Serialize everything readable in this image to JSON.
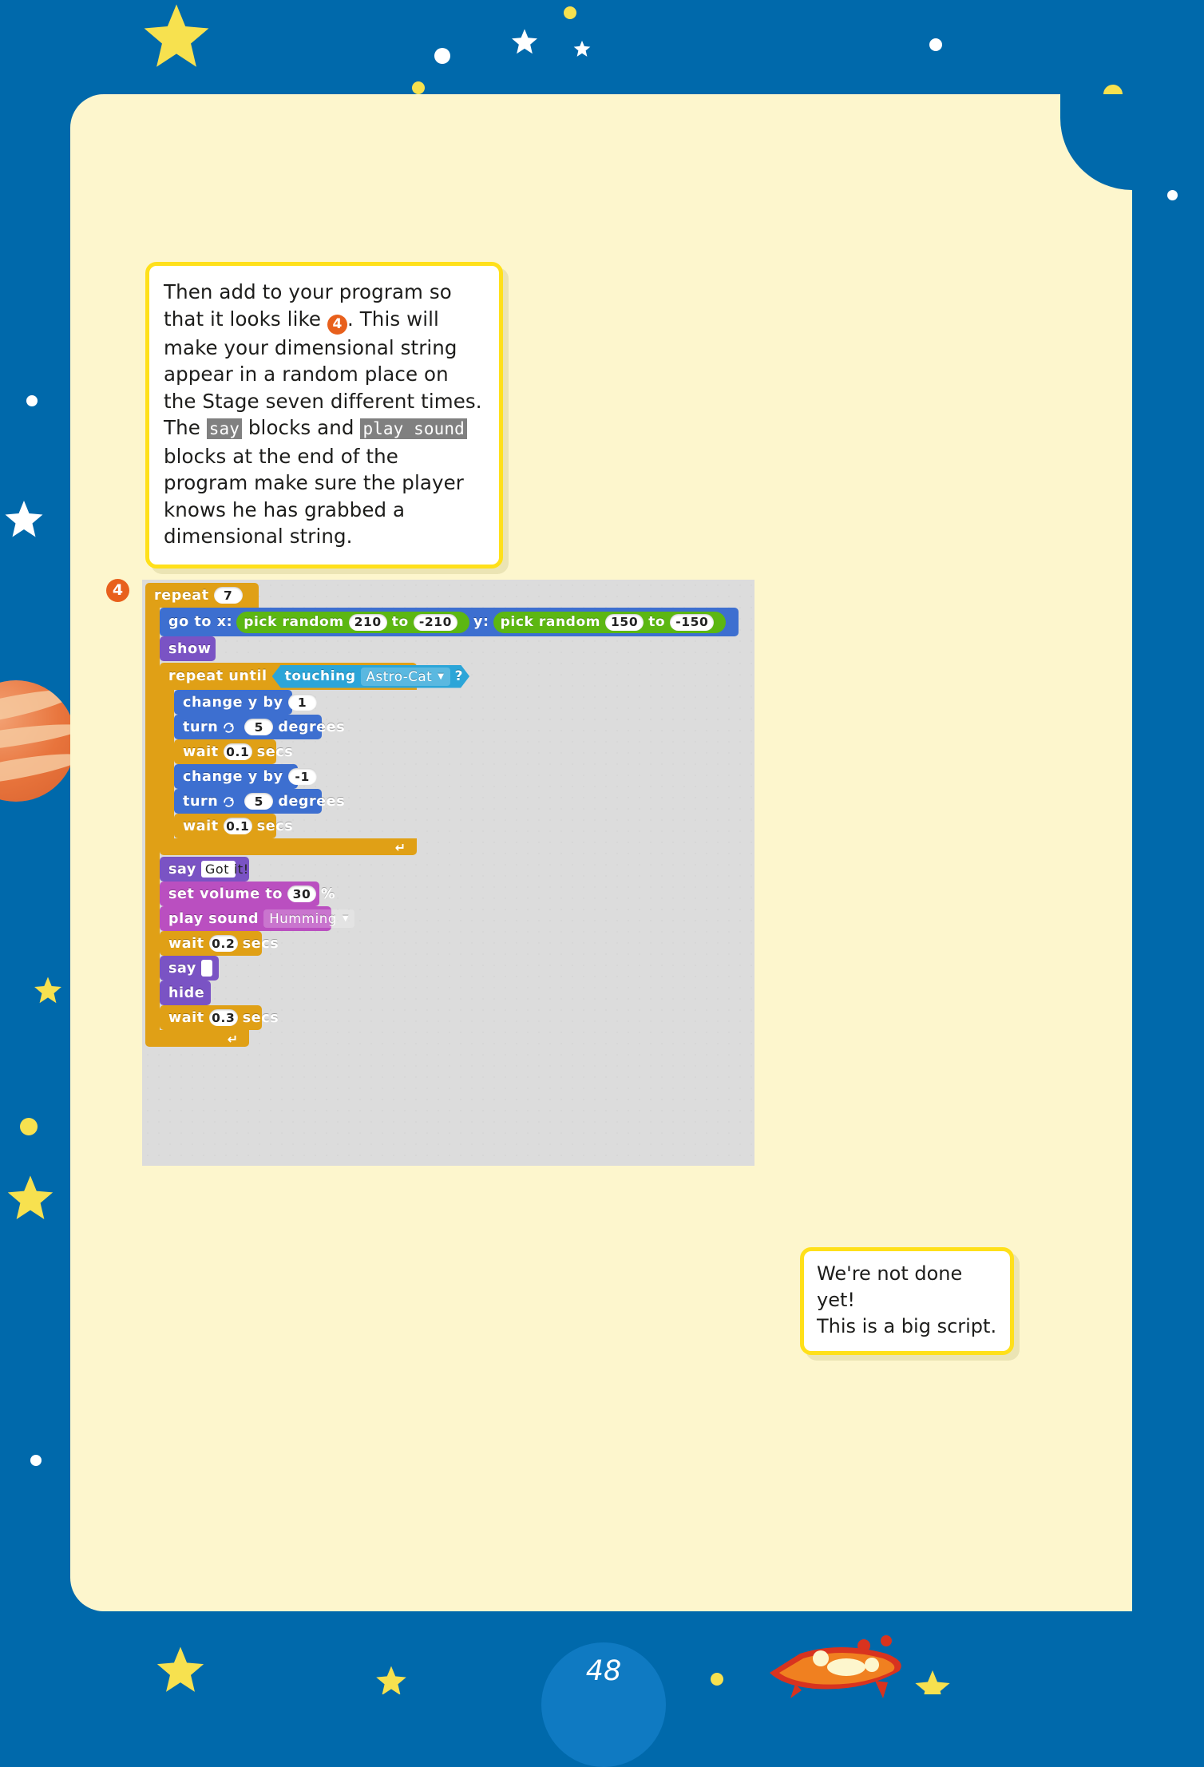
{
  "page": {
    "number": "48",
    "background_color": "#0069ab",
    "paper_color": "#fdf6cd",
    "accent_color": "#ffe01a",
    "marker_color": "#e8601c"
  },
  "callout": {
    "text_parts": {
      "p1": "Then add to your program so that it looks like ",
      "badge": "4",
      "p2": ". This will make your dimensional string appear in a random place on the Stage seven different times. The ",
      "code1": "say",
      "p3": " blocks and ",
      "code2": "play sound",
      "p4": " blocks at the end of the program make sure the player knows he has grabbed a dimensional string."
    },
    "full_text": "Then add to your program so that it looks like 4. This will make your dimensional string appear in a random place on the Stage seven different times. The say blocks and play sound blocks at the end of the program make sure the player knows he has grabbed a dimensional string."
  },
  "step_marker": {
    "label": "4"
  },
  "script": {
    "outer_repeat": {
      "label": "repeat",
      "times": "7"
    },
    "go_to": {
      "label_x": "go to x:",
      "label_y": "y:",
      "x_random": {
        "label": "pick random",
        "from": "210",
        "to_label": "to",
        "to": "-210"
      },
      "y_random": {
        "label": "pick random",
        "from": "150",
        "to_label": "to",
        "to": "-150"
      }
    },
    "show": {
      "label": "show"
    },
    "repeat_until": {
      "label": "repeat until",
      "condition": {
        "label": "touching",
        "target": "Astro-Cat",
        "question": "?"
      },
      "body": [
        {
          "kind": "motion",
          "label": "change y by",
          "value": "1"
        },
        {
          "kind": "motion",
          "label": "turn",
          "icon": "turn-cw-icon",
          "value": "5",
          "suffix": "degrees"
        },
        {
          "kind": "control",
          "label": "wait",
          "value": "0.1",
          "suffix": "secs"
        },
        {
          "kind": "motion",
          "label": "change y by",
          "value": "-1"
        },
        {
          "kind": "motion",
          "label": "turn",
          "icon": "turn-cw-icon",
          "value": "5",
          "suffix": "degrees"
        },
        {
          "kind": "control",
          "label": "wait",
          "value": "0.1",
          "suffix": "secs"
        }
      ]
    },
    "tail": [
      {
        "kind": "looks",
        "label": "say",
        "value": "Got it!"
      },
      {
        "kind": "sound",
        "label": "set volume to",
        "value": "30",
        "suffix": "%"
      },
      {
        "kind": "sound",
        "label": "play sound",
        "dropdown": "Humming"
      },
      {
        "kind": "control",
        "label": "wait",
        "value": "0.2",
        "suffix": "secs"
      },
      {
        "kind": "looks",
        "label": "say",
        "value": ""
      },
      {
        "kind": "looks",
        "label": "hide"
      },
      {
        "kind": "control",
        "label": "wait",
        "value": "0.3",
        "suffix": "secs"
      }
    ]
  },
  "bubble": {
    "line1": "We're not done yet!",
    "line2": "This is a big script."
  }
}
